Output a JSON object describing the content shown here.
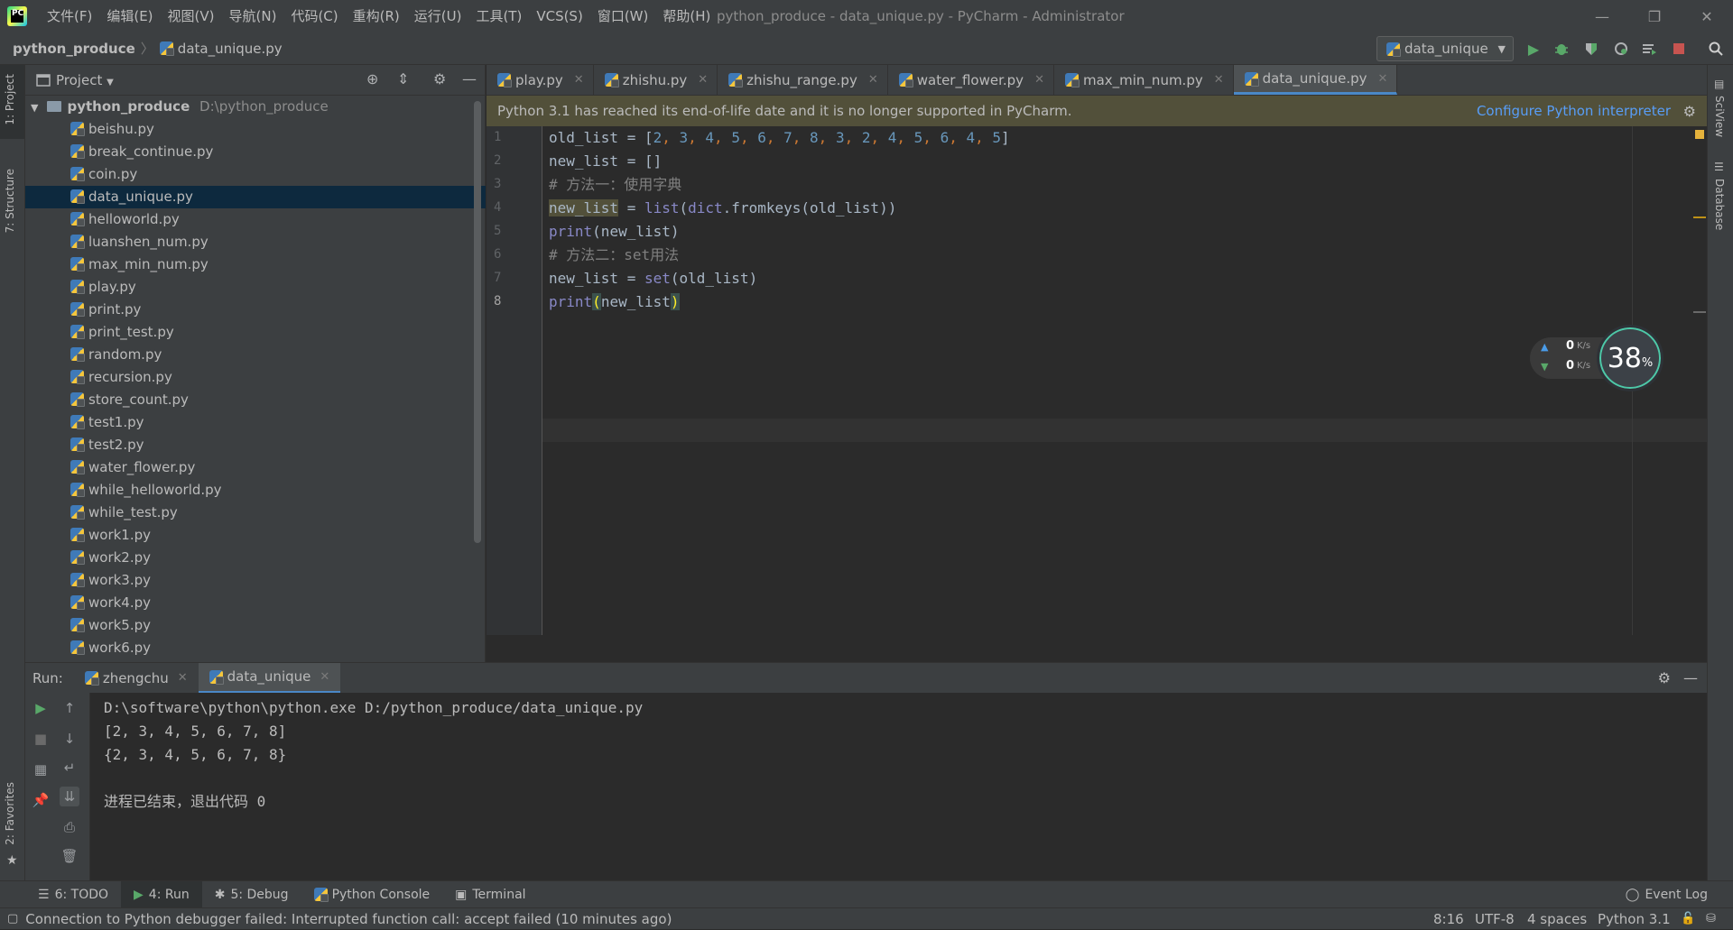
{
  "window": {
    "title": "python_produce - data_unique.py - PyCharm - Administrator",
    "menu": [
      "文件(F)",
      "编辑(E)",
      "视图(V)",
      "导航(N)",
      "代码(C)",
      "重构(R)",
      "运行(U)",
      "工具(T)",
      "VCS(S)",
      "窗口(W)",
      "帮助(H)"
    ],
    "controls": {
      "minimize": "—",
      "restore": "❐",
      "close": "✕"
    }
  },
  "breadcrumb": {
    "project": "python_produce",
    "sep": "〉",
    "file": "data_unique.py"
  },
  "run_config": {
    "name": "data_unique"
  },
  "left_strip": {
    "project_tab": "1: Project",
    "structure_tab": "7: Structure",
    "favorites_tab": "2: Favorites"
  },
  "right_strip": {
    "sciview_tab": "SciView",
    "database_tab": "Database"
  },
  "project_panel": {
    "title": "Project",
    "root": {
      "name": "python_produce",
      "path": "D:\\python_produce"
    },
    "files": [
      "beishu.py",
      "break_continue.py",
      "coin.py",
      "data_unique.py",
      "helloworld.py",
      "luanshen_num.py",
      "max_min_num.py",
      "play.py",
      "print.py",
      "print_test.py",
      "random.py",
      "recursion.py",
      "store_count.py",
      "test1.py",
      "test2.py",
      "water_flower.py",
      "while_helloworld.py",
      "while_test.py",
      "work1.py",
      "work2.py",
      "work3.py",
      "work4.py",
      "work5.py",
      "work6.py"
    ],
    "selected": "data_unique.py"
  },
  "editor_tabs": [
    {
      "label": "play.py"
    },
    {
      "label": "zhishu.py"
    },
    {
      "label": "zhishu_range.py"
    },
    {
      "label": "water_flower.py"
    },
    {
      "label": "max_min_num.py"
    },
    {
      "label": "data_unique.py",
      "active": true
    }
  ],
  "banner": {
    "message": "Python 3.1 has reached its end-of-life date and it is no longer supported in PyCharm.",
    "link": "Configure Python interpreter"
  },
  "editor": {
    "line_numbers": [
      "1",
      "2",
      "3",
      "4",
      "5",
      "6",
      "7",
      "8"
    ],
    "current_line": 8,
    "lines": [
      "old_list = [2, 3, 4, 5, 6, 7, 8, 3, 2, 4, 5, 6, 4, 5]",
      "new_list = []",
      "# 方法一：使用字典",
      "new_list = list(dict.fromkeys(old_list))",
      "print(new_list)",
      "# 方法二：set用法",
      "new_list = set(old_list)",
      "print(new_list)"
    ]
  },
  "net_widget": {
    "up": "0",
    "down": "0",
    "unit": "K/s",
    "percent": "38",
    "percent_sign": "%"
  },
  "run_panel": {
    "label": "Run:",
    "tabs": [
      {
        "label": "zhengchu"
      },
      {
        "label": "data_unique",
        "active": true
      }
    ],
    "console": [
      "D:\\software\\python\\python.exe D:/python_produce/data_unique.py",
      "[2, 3, 4, 5, 6, 7, 8]",
      "{2, 3, 4, 5, 6, 7, 8}",
      "",
      "进程已结束，退出代码 0"
    ]
  },
  "tool_tabs": [
    {
      "label": "6: TODO"
    },
    {
      "label": "4: Run",
      "active": true
    },
    {
      "label": "5: Debug"
    },
    {
      "label": "Python Console"
    },
    {
      "label": "Terminal"
    }
  ],
  "event_log": "Event Log",
  "status": {
    "message": "Connection to Python debugger failed: Interrupted function call: accept failed (10 minutes ago)",
    "position": "8:16",
    "encoding": "UTF-8",
    "indent": "4 spaces",
    "interpreter": "Python 3.1"
  },
  "colors": {
    "accent": "#4a88c7",
    "run_green": "#59a869",
    "stop_red": "#c75450",
    "link": "#589df6"
  }
}
